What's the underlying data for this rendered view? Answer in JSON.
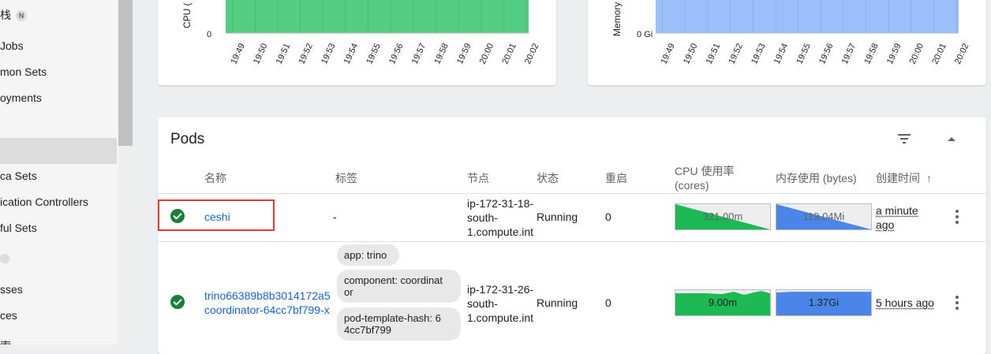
{
  "sidebar": {
    "items": [
      {
        "label": "栈",
        "badge": "N"
      },
      {
        "label": "Jobs"
      },
      {
        "label": "mon Sets"
      },
      {
        "label": "oyments"
      },
      {
        "label": ""
      },
      {
        "label": ""
      },
      {
        "label": "ca Sets"
      },
      {
        "label": "ication Controllers"
      },
      {
        "label": "ful Sets"
      },
      {
        "label": ""
      },
      {
        "label": "sses"
      },
      {
        "label": "ces"
      },
      {
        "label": "索"
      }
    ]
  },
  "cpu_chart": {
    "ylabel": "CPU (",
    "y_tick": "0",
    "x_ticks": [
      "19:49",
      "19:50",
      "19:51",
      "19:52",
      "19:53",
      "19:54",
      "19:55",
      "19:56",
      "19:57",
      "19:58",
      "19:59",
      "20:00",
      "20:01",
      "20:02"
    ],
    "fill_color": "#34c46b"
  },
  "memory_chart": {
    "ylabel": "Memory",
    "y_tick": "0 Gi",
    "x_ticks": [
      "19:49",
      "19:50",
      "19:51",
      "19:52",
      "19:53",
      "19:54",
      "19:55",
      "19:56",
      "19:57",
      "19:58",
      "19:59",
      "20:00",
      "20:01",
      "20:02"
    ],
    "fill_color": "#8ab4f8"
  },
  "pods": {
    "title": "Pods",
    "columns": {
      "name": "名称",
      "labels": "标签",
      "node": "节点",
      "status": "状态",
      "restarts": "重启",
      "cpu_line1": "CPU 使用率",
      "cpu_line2": "(cores)",
      "memory": "内存使用 (bytes)",
      "created": "创建时间"
    },
    "rows": [
      {
        "name": "ceshi",
        "labels": "-",
        "node_l1": "ip-172-31-18-",
        "node_l2": "south-",
        "node_l3": "1.compute.int",
        "status": "Running",
        "restarts": "0",
        "cpu": "321.00m",
        "memory": "119.04Mi",
        "created_l1": "a minute",
        "created_l2": "ago"
      },
      {
        "name_l1": "trino66389b8b3014172a5",
        "name_l2": "coordinator-64cc7bf799-x",
        "label_1": "app: trino",
        "label_2a": "component: coordinat",
        "label_2b": "or",
        "label_3a": "pod-template-hash: 6",
        "label_3b": "4cc7bf799",
        "node_l1": "ip-172-31-26-",
        "node_l2": "south-",
        "node_l3": "1.compute.int",
        "status": "Running",
        "restarts": "0",
        "cpu": "9.00m",
        "memory": "1.37Gi",
        "created": "5 hours ago"
      }
    ]
  },
  "colors": {
    "accent_link": "#1a64d8",
    "status_ok": "#188038",
    "highlight": "#e53935",
    "cpu_green": "#1db954",
    "mem_blue": "#4a86e8"
  }
}
